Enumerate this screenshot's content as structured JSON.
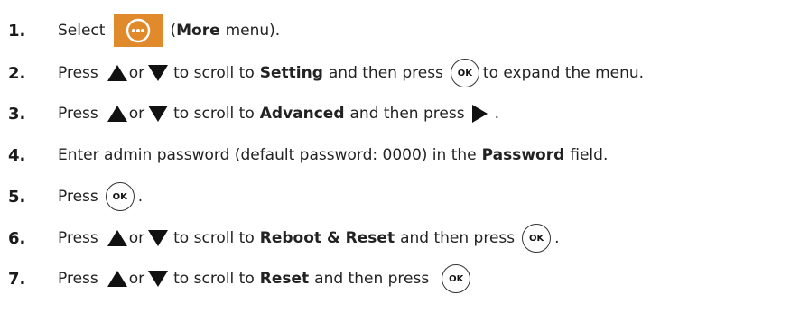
{
  "steps": [
    {
      "number": "1.",
      "segments": {
        "a": "Select",
        "b": "(",
        "c": "More",
        "d": "menu)."
      }
    },
    {
      "number": "2.",
      "segments": {
        "a": "Press",
        "b": "or",
        "c": "to scroll to",
        "d": "Setting",
        "e": "and then press",
        "f": "to expand the menu."
      }
    },
    {
      "number": "3.",
      "segments": {
        "a": "Press",
        "b": "or",
        "c": "to scroll to",
        "d": "Advanced",
        "e": "and then press",
        "f": "."
      }
    },
    {
      "number": "4.",
      "segments": {
        "a": "Enter admin password (default password: 0000) in the",
        "b": "Password",
        "c": "field."
      }
    },
    {
      "number": "5.",
      "segments": {
        "a": "Press",
        "b": "."
      }
    },
    {
      "number": "6.",
      "segments": {
        "a": "Press",
        "b": "or",
        "c": "to scroll to",
        "d": "Reboot & Reset",
        "e": "and then press",
        "f": "."
      }
    },
    {
      "number": "7.",
      "segments": {
        "a": "Press",
        "b": "or",
        "c": "to scroll to",
        "d": "Reset",
        "e": "and then press"
      }
    }
  ],
  "ok_button_label": "OK",
  "icons": {
    "more": "more-menu-icon",
    "up": "up-arrow-icon",
    "down": "down-arrow-icon",
    "right": "right-arrow-icon",
    "ok": "ok-button-icon"
  },
  "colors": {
    "more_button_bg": "#e08a2c",
    "text": "#222222"
  }
}
